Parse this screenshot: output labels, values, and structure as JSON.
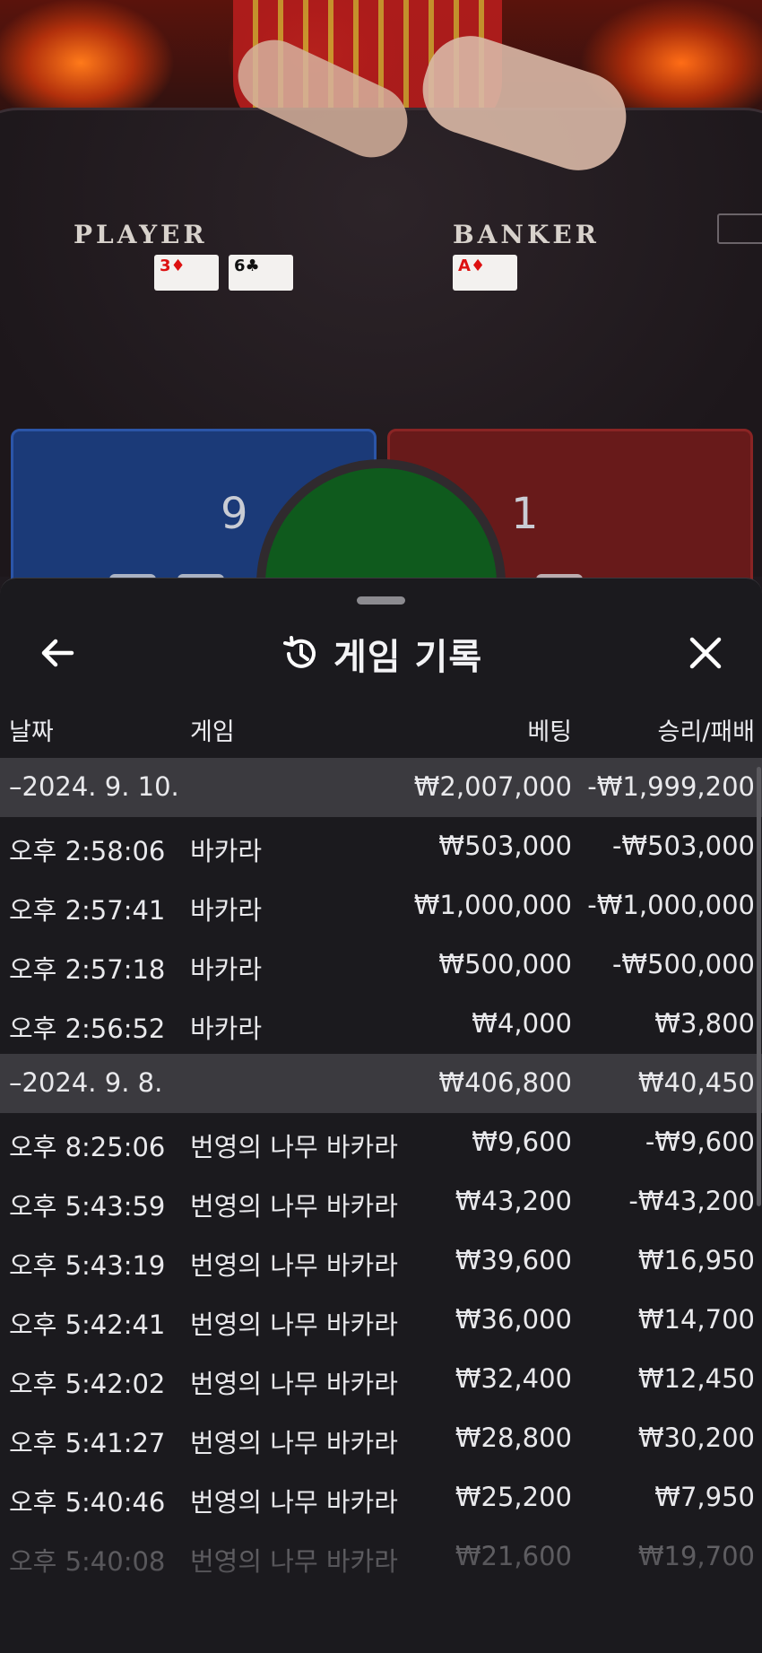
{
  "scene": {
    "player_label": "PLAYER",
    "banker_label": "BANKER",
    "player_cards": [
      {
        "rank": "3",
        "suit": "♦",
        "color": "red"
      },
      {
        "rank": "6",
        "suit": "♣",
        "color": "black"
      }
    ],
    "banker_cards": [
      {
        "rank": "A",
        "suit": "♦",
        "color": "red"
      }
    ],
    "player_score": "9",
    "banker_score": "1"
  },
  "sheet": {
    "title": "게임 기록",
    "icons": {
      "back": "back-arrow-icon",
      "history": "history-icon",
      "close": "close-icon"
    },
    "columns": {
      "date": "날짜",
      "game": "게임",
      "bet": "베팅",
      "result": "승리/패배"
    },
    "groups": [
      {
        "date": "–2024. 9. 10.",
        "bet": "₩2,007,000",
        "result": "-₩1,999,200",
        "rows": [
          {
            "time": "오후 2:58:06",
            "game": "바카라",
            "bet": "₩503,000",
            "result": "-₩503,000"
          },
          {
            "time": "오후 2:57:41",
            "game": "바카라",
            "bet": "₩1,000,000",
            "result": "-₩1,000,000"
          },
          {
            "time": "오후 2:57:18",
            "game": "바카라",
            "bet": "₩500,000",
            "result": "-₩500,000"
          },
          {
            "time": "오후 2:56:52",
            "game": "바카라",
            "bet": "₩4,000",
            "result": "₩3,800"
          }
        ]
      },
      {
        "date": "–2024. 9. 8.",
        "bet": "₩406,800",
        "result": "₩40,450",
        "rows": [
          {
            "time": "오후 8:25:06",
            "game": "번영의 나무 바카라",
            "bet": "₩9,600",
            "result": "-₩9,600"
          },
          {
            "time": "오후 5:43:59",
            "game": "번영의 나무 바카라",
            "bet": "₩43,200",
            "result": "-₩43,200"
          },
          {
            "time": "오후 5:43:19",
            "game": "번영의 나무 바카라",
            "bet": "₩39,600",
            "result": "₩16,950"
          },
          {
            "time": "오후 5:42:41",
            "game": "번영의 나무 바카라",
            "bet": "₩36,000",
            "result": "₩14,700"
          },
          {
            "time": "오후 5:42:02",
            "game": "번영의 나무 바카라",
            "bet": "₩32,400",
            "result": "₩12,450"
          },
          {
            "time": "오후 5:41:27",
            "game": "번영의 나무 바카라",
            "bet": "₩28,800",
            "result": "₩30,200"
          },
          {
            "time": "오후 5:40:46",
            "game": "번영의 나무 바카라",
            "bet": "₩25,200",
            "result": "₩7,950"
          },
          {
            "time": "오후 5:40:08",
            "game": "번영의 나무 바카라",
            "bet": "₩21,600",
            "result": "₩19,700"
          }
        ]
      }
    ]
  }
}
